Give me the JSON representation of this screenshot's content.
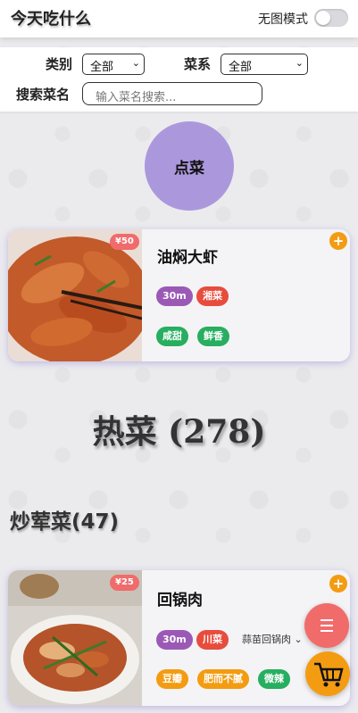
{
  "header": {
    "title": "今天吃什么",
    "mode_label": "无图模式",
    "mode_on": false
  },
  "filters": {
    "category_label": "类别",
    "category_value": "全部",
    "cuisine_label": "菜系",
    "cuisine_value": "全部",
    "search_label": "搜索菜名",
    "search_placeholder": "输入菜名搜索..."
  },
  "order_button": "点菜",
  "dishes": [
    {
      "name": "油焖大虾",
      "price": "¥50",
      "tags": [
        "30m",
        "湘菜",
        "咸甜",
        "鲜香"
      ]
    },
    {
      "name": "回锅肉",
      "price": "¥25",
      "tags": [
        "30m",
        "川菜",
        "豆瓣",
        "肥而不腻",
        "微辣"
      ],
      "variant": "蒜苗回锅肉"
    }
  ],
  "sections": {
    "category_title": "热菜 (278)",
    "subcategory_title": "炒荤菜(47)"
  },
  "icons": {
    "menu": "menu-icon",
    "cart": "cart-icon",
    "chevron": "chevron-down-icon",
    "plus": "plus-icon"
  },
  "colors": {
    "accent": "#ab98dc",
    "price": "#f06b6b",
    "add": "#f39c12"
  }
}
